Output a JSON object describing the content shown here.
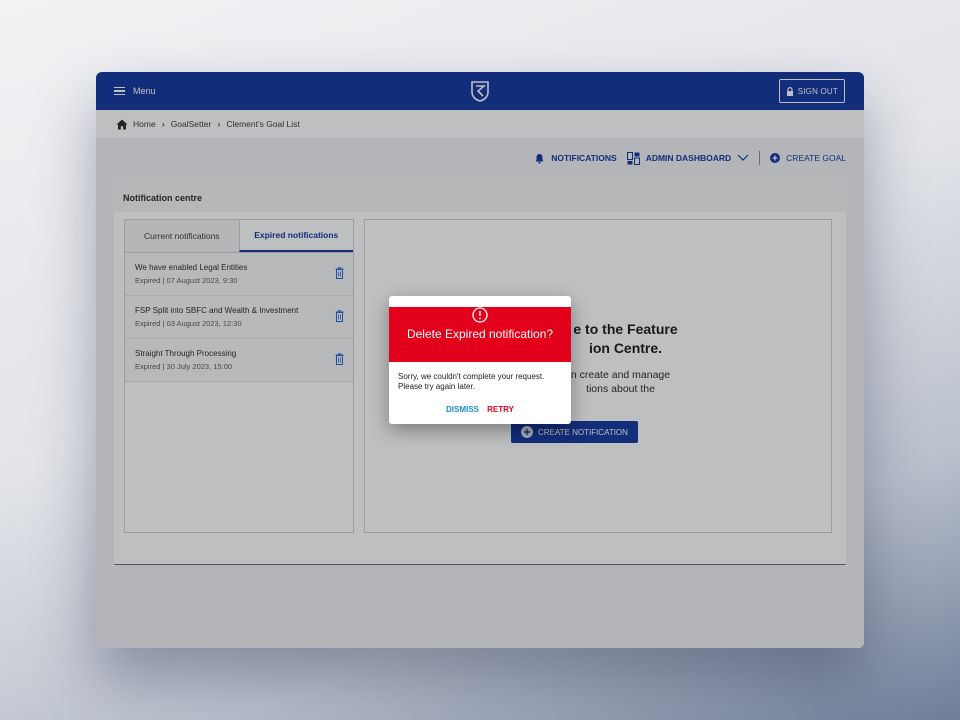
{
  "topbar": {
    "menu_label": "Menu",
    "signout_label": "SIGN OUT"
  },
  "breadcrumb": {
    "items": [
      "Home",
      "GoalSetter",
      "Clement's Goal List"
    ]
  },
  "actions": {
    "notifications": "NOTIFICATIONS",
    "admin_dashboard": "ADMIN DASHBOARD",
    "create_goal": "CREATE GOAL"
  },
  "card": {
    "title": "Notification centre",
    "tabs": {
      "current": "Current notifications",
      "expired": "Expired notifications"
    },
    "notifications": [
      {
        "title": "We have enabled Legal Entities",
        "meta": "Expired | 07 August 2023, 9:30"
      },
      {
        "title": "FSP Split into SBFC and Wealth & Investment",
        "meta": "Expired | 03 August 2023, 12:30"
      },
      {
        "title": "Straight Through Processing",
        "meta": "Expired | 30 July 2023, 15:00"
      }
    ],
    "welcome": {
      "title_line1": "e to the Feature",
      "title_line2": "ion Centre.",
      "text_line1": "n create and manage",
      "text_line2": "tions about the",
      "button": "CREATE NOTIFICATION"
    }
  },
  "dialog": {
    "title": "Delete Expired notification?",
    "message_line1": "Sorry, we couldn't complete your request.",
    "message_line2": "Please try again later.",
    "dismiss": "DISMISS",
    "retry": "RETRY"
  },
  "colors": {
    "brand": "#0a2f9b",
    "danger": "#e2001a",
    "link": "#1a8fd0"
  }
}
